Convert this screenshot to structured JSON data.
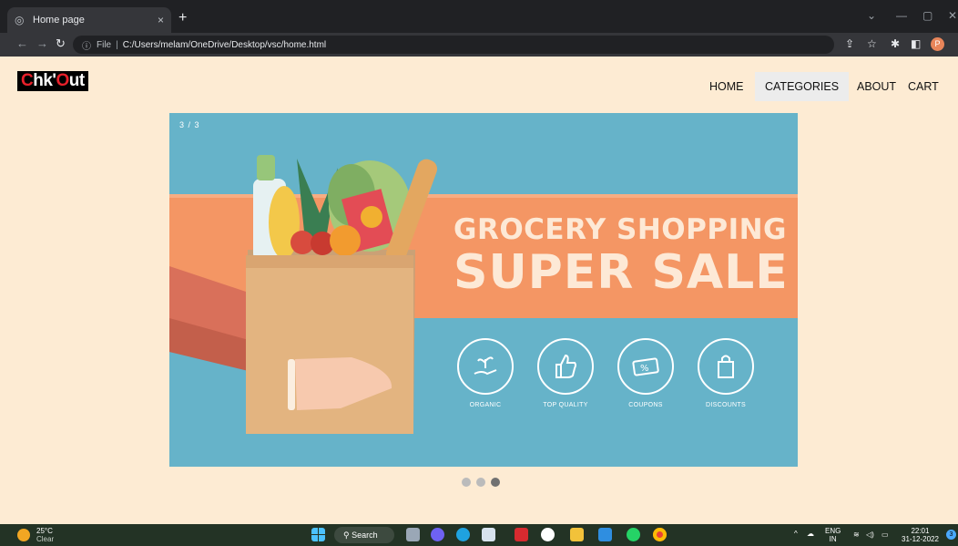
{
  "browser": {
    "tab_title": "Home page",
    "tab_close": "×",
    "new_tab": "+",
    "address": {
      "security_label": "File",
      "url": "C:/Users/melam/OneDrive/Desktop/vsc/home.html"
    },
    "profile_initial": "P",
    "icons": [
      "globe-icon",
      "back-icon",
      "forward-icon",
      "reload-icon",
      "info-icon",
      "share-icon",
      "star-icon",
      "extensions-icon",
      "side-panel-icon",
      "minimize-icon",
      "maximize-icon",
      "close-icon"
    ]
  },
  "site": {
    "logo": {
      "part1": "C",
      "part2": "hk'",
      "part3": "O",
      "part4": "ut"
    },
    "nav": [
      {
        "label": "HOME",
        "active": false
      },
      {
        "label": "CATEGORIES",
        "active": true
      },
      {
        "label": "ABOUT",
        "active": false
      },
      {
        "label": "CART",
        "active": false
      }
    ],
    "slideshow": {
      "counter": "3 / 3",
      "banner": {
        "line1": "GROCERY SHOPPING",
        "line2": "SUPER SALE",
        "features": [
          {
            "label": "ORGANIC",
            "icon": "plant-in-hand-icon"
          },
          {
            "label": "TOP QUALITY",
            "icon": "thumbs-up-icon"
          },
          {
            "label": "COUPONS",
            "icon": "coupon-icon"
          },
          {
            "label": "DISCOUNTS",
            "icon": "shopping-bag-icon"
          }
        ]
      },
      "dots": 3,
      "active_dot": 3
    }
  },
  "taskbar": {
    "weather": {
      "temp": "25°C",
      "condition": "Clear"
    },
    "search_label": "Search",
    "language": {
      "line1": "ENG",
      "line2": "IN"
    },
    "clock": {
      "time": "22:01",
      "date": "31-12-2022"
    },
    "notification_count": "3",
    "colors": {
      "taskbar": "#233325",
      "page_background": "#fdebd3",
      "banner_blue": "#66b3c9",
      "banner_orange": "#f49664"
    }
  }
}
